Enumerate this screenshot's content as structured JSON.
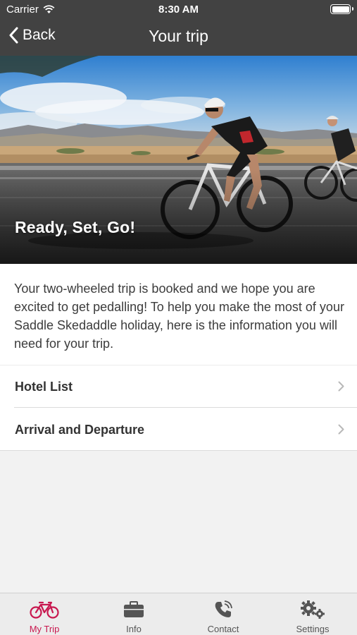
{
  "status_bar": {
    "carrier": "Carrier",
    "time": "8:30 AM"
  },
  "nav": {
    "back_label": "Back",
    "title": "Your trip"
  },
  "hero": {
    "caption": "Ready, Set, Go!"
  },
  "intro_text": "Your two-wheeled trip is booked and we hope you are excited to get pedalling! To help you make the most of your Saddle Skedaddle holiday, here is the information you will need for your trip.",
  "list": [
    {
      "label": "Hotel List"
    },
    {
      "label": "Arrival and Departure"
    }
  ],
  "tabs": [
    {
      "label": "My Trip",
      "icon": "bicycle-icon",
      "active": true
    },
    {
      "label": "Info",
      "icon": "briefcase-icon",
      "active": false
    },
    {
      "label": "Contact",
      "icon": "phone-icon",
      "active": false
    },
    {
      "label": "Settings",
      "icon": "gears-icon",
      "active": false
    }
  ],
  "colors": {
    "nav_background": "#424242",
    "accent": "#c8184f",
    "tab_inactive": "#555555",
    "page_background": "#f2f2f2"
  }
}
